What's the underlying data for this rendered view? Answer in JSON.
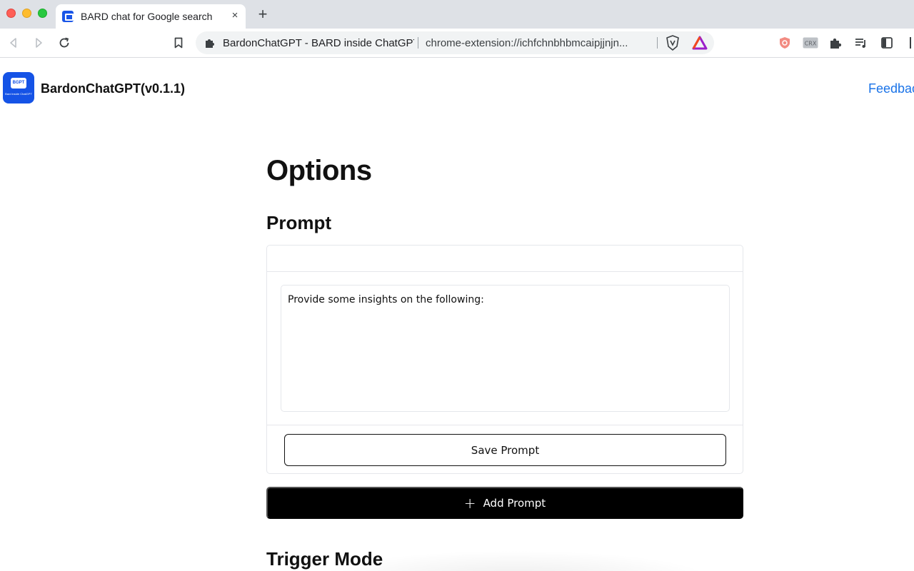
{
  "browser": {
    "tab": {
      "title": "BARD chat for Google search",
      "close_glyph": "×"
    },
    "new_tab_glyph": "+",
    "omnibox": {
      "page_title": "BardonChatGPT - BARD inside ChatGPT",
      "url": "chrome-extension://ichfchnbhbmcaipjjnjn..."
    }
  },
  "app": {
    "name": "BardonChatGPT(v0.1.1)",
    "logo_text": "BGPT",
    "logo_tagline": "Bard inside ChatGPT",
    "feedback_label": "Feedback"
  },
  "options": {
    "title": "Options",
    "prompt_section": {
      "title": "Prompt",
      "prompt_value": "Provide some insights on the following:",
      "save_label": "Save Prompt"
    },
    "add_prompt": {
      "icon_glyph": "+",
      "label": "Add Prompt"
    },
    "trigger_section": {
      "title": "Trigger Mode"
    }
  },
  "colors": {
    "accent_link": "#1a73e8",
    "logo_blue": "#1553e6",
    "primary_button": "#000000"
  }
}
